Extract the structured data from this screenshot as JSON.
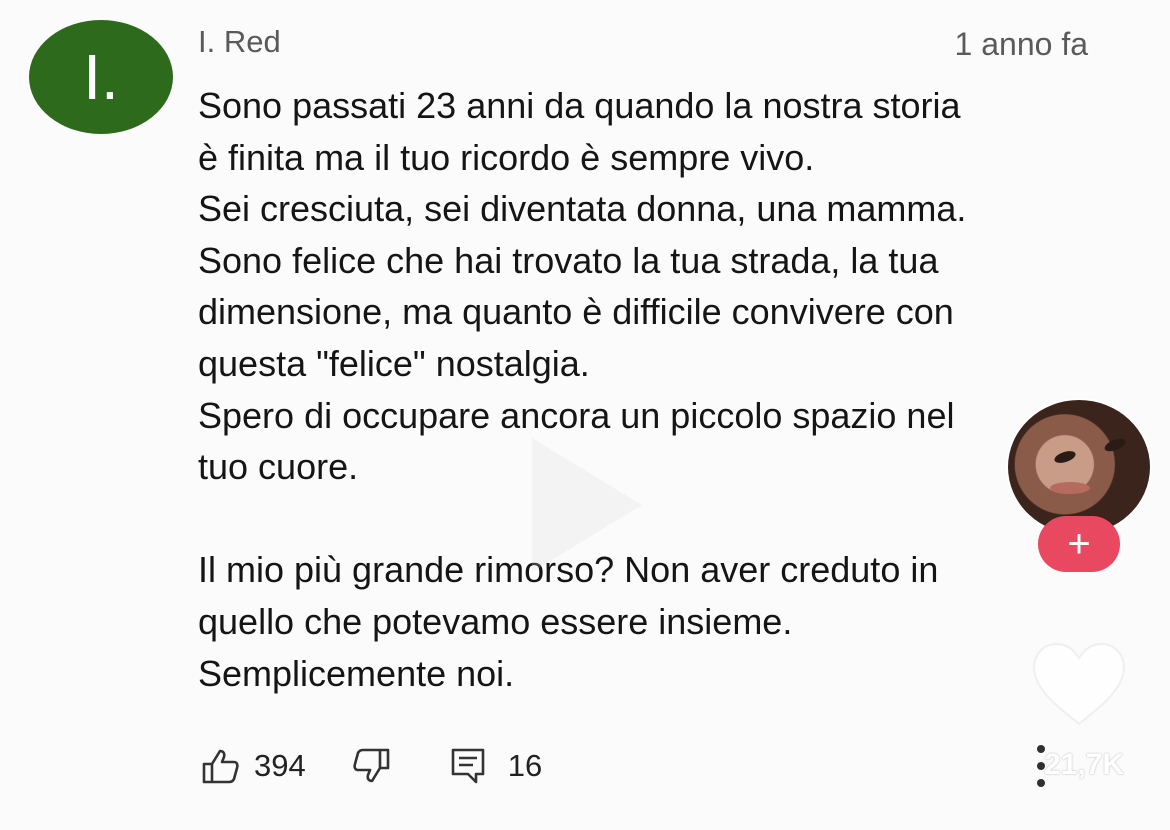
{
  "comment": {
    "avatar_letter": "I.",
    "avatar_color": "#2d6a1b",
    "author": "I. Red",
    "time": "1 anno fa",
    "lines": [
      "Sono passati 23 anni da quando la nostra storia",
      "è finita ma il tuo ricordo è sempre vivo.",
      "Sei cresciuta, sei diventata donna, una mamma.",
      "Sono felice che hai trovato la tua strada, la tua",
      "dimensione, ma quanto è difficile convivere con",
      "questa \"felice\" nostalgia.",
      "Spero di occupare ancora un piccolo spazio nel",
      "tuo cuore.",
      "",
      "Il mio più grande rimorso? Non aver creduto in",
      "quello che potevamo essere insieme.",
      "Semplicemente noi."
    ],
    "likes": "394",
    "replies": "16"
  },
  "overlay": {
    "follow_label": "+",
    "follow_color": "#e84860",
    "heart_count": "21,7K"
  },
  "icons": {
    "like": "thumb-up-icon",
    "dislike": "thumb-down-icon",
    "reply": "reply-icon",
    "more": "more-vertical-icon",
    "play": "play-icon",
    "heart": "heart-icon"
  }
}
